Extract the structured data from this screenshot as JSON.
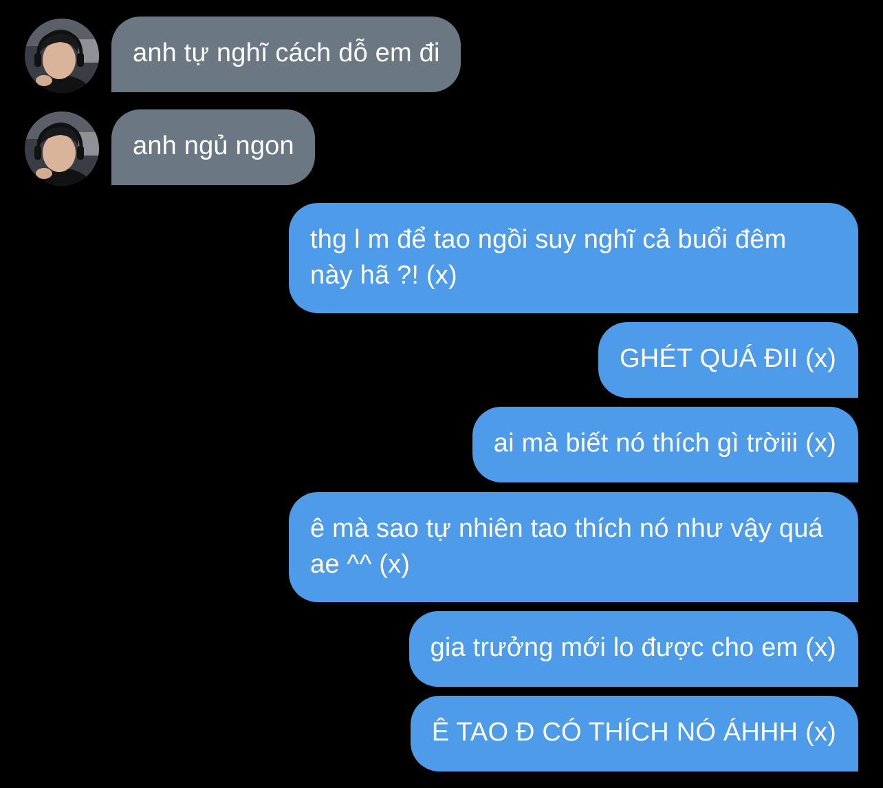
{
  "contact": {
    "avatar_icon": "person-headset-avatar"
  },
  "colors": {
    "background": "#000000",
    "incoming_bubble": "#6b7782",
    "outgoing_bubble": "#4e9bea",
    "text": "#ffffff"
  },
  "messages": {
    "incoming": [
      {
        "text": "anh tự nghĩ cách dỗ em đi"
      },
      {
        "text": "anh ngủ ngon"
      }
    ],
    "outgoing": [
      {
        "text": "thg l m để tao ngồi suy nghĩ cả buổi đêm này hã ?! (x)"
      },
      {
        "text": "GHÉT QUÁ ĐII (x)"
      },
      {
        "text": "ai mà biết nó thích gì trờiii (x)"
      },
      {
        "text": "ê mà sao tự nhiên tao thích nó như vậy quá ae ^^ (x)"
      },
      {
        "text": "gia trưởng mới lo được cho em (x)"
      },
      {
        "text": "Ê TAO Đ CÓ THÍCH NÓ ÁHHH (x)"
      }
    ]
  }
}
